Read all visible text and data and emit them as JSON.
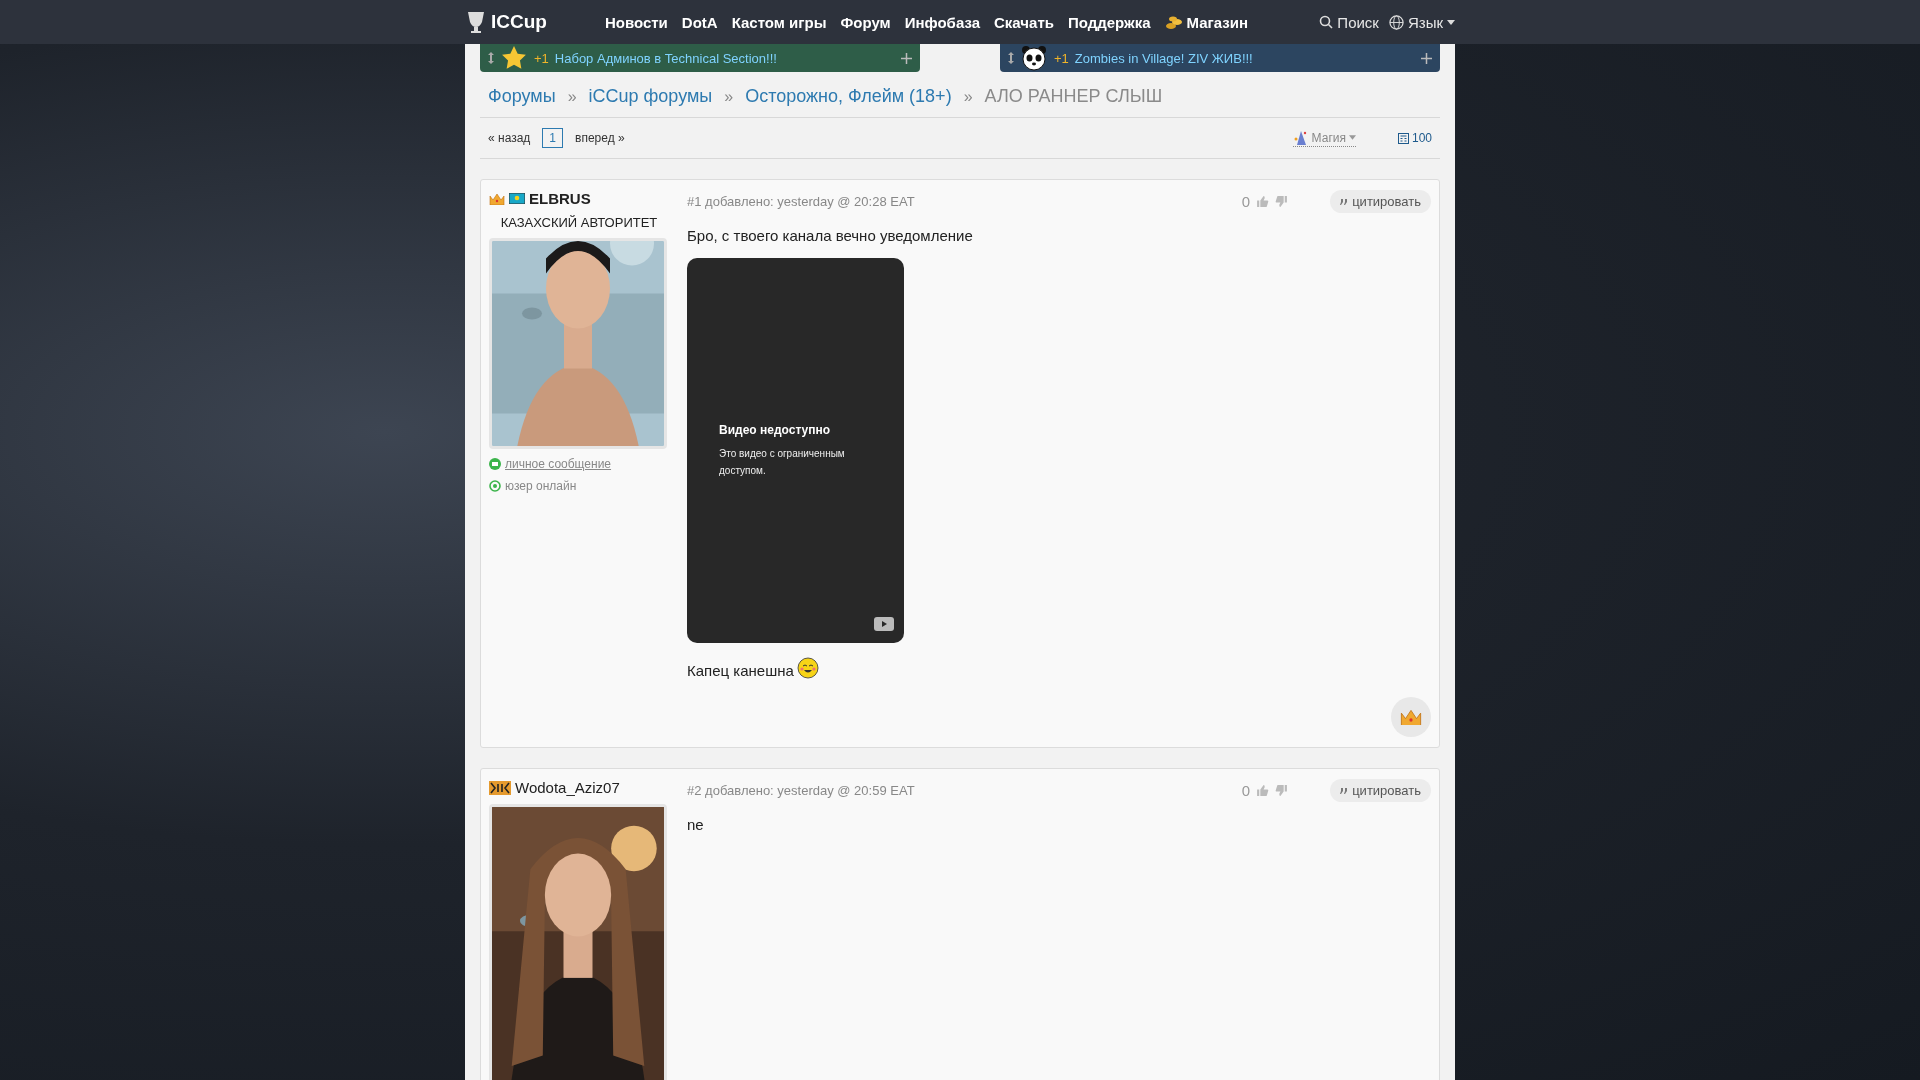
{
  "nav": {
    "logo": "ICCup",
    "items": [
      {
        "label": "Новости",
        "kind": "plain"
      },
      {
        "label": "DotA",
        "kind": "plain"
      },
      {
        "label": "Кастом игры",
        "kind": "plain"
      },
      {
        "label": "Форум",
        "kind": "plain"
      },
      {
        "label": "Инфобаза",
        "kind": "plain"
      },
      {
        "label": "Скачать",
        "kind": "plain"
      },
      {
        "label": "Поддержка",
        "kind": "plain"
      },
      {
        "label": "Магазин",
        "kind": "shop"
      }
    ],
    "search": "Поиск",
    "language": "Язык"
  },
  "announcements": [
    {
      "plus": "+1",
      "text": "Набор Админов в Technical Section!!!",
      "color": "#2e5d48",
      "kind": "star"
    },
    {
      "plus": "+1",
      "text": "Zombies in Village! ZIV ЖИВ!!!",
      "color": "#2c4560",
      "kind": "panda"
    }
  ],
  "breadcrumb": [
    {
      "label": "Форумы",
      "selected": false
    },
    {
      "separator": "»",
      "label": "iCCup форумы",
      "selected": false
    },
    {
      "separator": "»",
      "label": "Осторожно, Флейм (18+)",
      "selected": false
    },
    {
      "separator": "»",
      "label": "АЛО РАННЕР СЛЫШ",
      "selected": true
    }
  ],
  "pager": {
    "prev": "« назад",
    "pages": [
      {
        "label": "1",
        "selected": true
      }
    ],
    "next": "вперед »",
    "magic": "Магия",
    "count": "100"
  },
  "posts": [
    {
      "author": "ELBRUS",
      "kind": "flag",
      "title": "КАЗАХСКИЙ АВТОРИТЕТ",
      "number": "#1",
      "meta": "добавлено: yesterday @ 20:28 EAT",
      "score": "0",
      "quote": "цитировать",
      "links": [
        {
          "kind": "message",
          "label": "личное сообщение"
        },
        {
          "kind": "online",
          "label": "юзер онлайн"
        }
      ],
      "reaction": true,
      "content": [
        {
          "kind": "text",
          "text": "Бро, с твоего канала вечно уведомление"
        },
        {
          "kind": "video",
          "title": "Видео недоступно",
          "subtitle": "Это видео с ограниченным доступом."
        },
        {
          "kind": "text",
          "text": "Капец канешна",
          "emoji": true
        }
      ]
    },
    {
      "author": "Wodota_Aziz07",
      "kind": "tiger",
      "number": "#2",
      "meta": "добавлено: yesterday @ 20:59 EAT",
      "score": "0",
      "quote": "цитировать",
      "reaction": false,
      "content": [
        {
          "kind": "text",
          "text": "ne"
        }
      ]
    }
  ]
}
